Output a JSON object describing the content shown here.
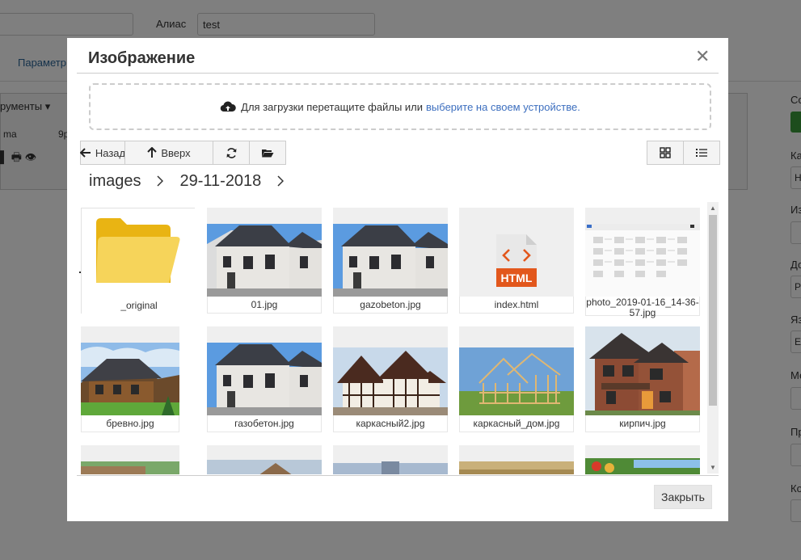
{
  "background": {
    "alias_label": "Алиас",
    "alias_value": "test",
    "params_tab": "Параметр",
    "editor_menu": "рументы ▾",
    "editor_font": "ma",
    "editor_size": "9p",
    "right_labels": [
      "Со",
      "Ка",
      "Из",
      "До",
      "Яз",
      "Ме",
      "Пр",
      "Ко"
    ],
    "right_values": [
      "Н",
      "Р",
      "Е"
    ]
  },
  "modal": {
    "title": "Изображение",
    "close_symbol": "✕",
    "dropzone_text": "Для загрузки перетащите файлы или",
    "dropzone_link": "выберите на своем устройстве.",
    "toolbar": {
      "back_label": "Назад",
      "up_label": "Вверх"
    },
    "breadcrumb": [
      "images",
      "29-11-2018"
    ],
    "files": [
      {
        "name": "_original",
        "kind": "folder"
      },
      {
        "name": "01.jpg",
        "kind": "house-gray"
      },
      {
        "name": "gazobeton.jpg",
        "kind": "house-gray"
      },
      {
        "name": "index.html",
        "kind": "html"
      },
      {
        "name": "photo_2019-01-16_14-36-57.jpg",
        "kind": "screenshot"
      },
      {
        "name": "бревно.jpg",
        "kind": "log-house"
      },
      {
        "name": "газобетон.jpg",
        "kind": "house-gray"
      },
      {
        "name": "каркасный2.jpg",
        "kind": "tudor"
      },
      {
        "name": "каркасный_дом.jpg",
        "kind": "frame"
      },
      {
        "name": "кирпич.jpg",
        "kind": "brick"
      },
      {
        "name": "",
        "kind": "partial-green"
      },
      {
        "name": "",
        "kind": "partial-roof"
      },
      {
        "name": "",
        "kind": "partial-blue"
      },
      {
        "name": "",
        "kind": "partial-field"
      },
      {
        "name": "",
        "kind": "partial-veg"
      }
    ],
    "html_badge": "HTML",
    "close_button": "Закрыть"
  },
  "colors": {
    "link": "#3d6fbf",
    "folder": "#f2c21b",
    "html_orange": "#e2571c",
    "overlay": "rgba(0,0,0,0.5)"
  }
}
